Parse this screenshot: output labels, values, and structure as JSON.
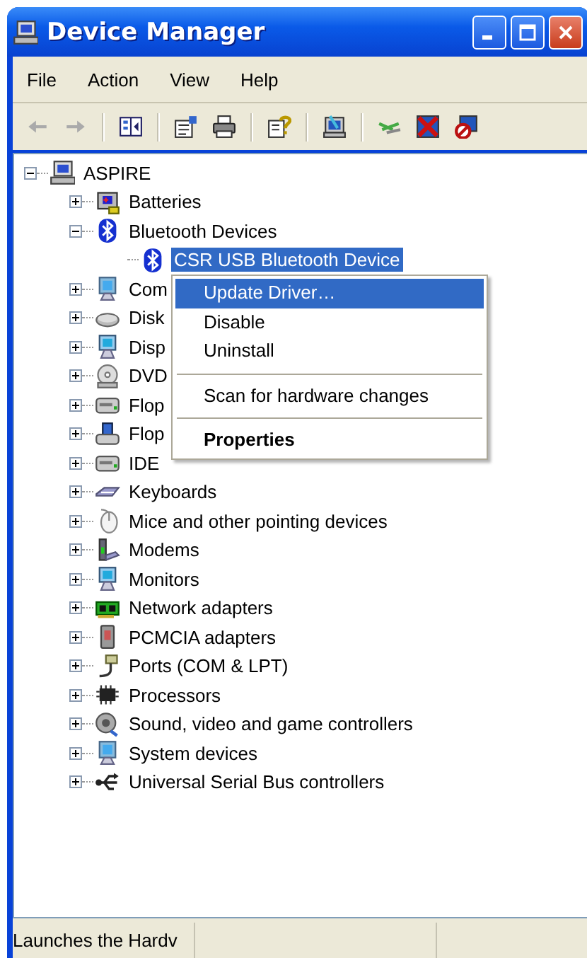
{
  "window": {
    "title": "Device Manager"
  },
  "menu_bar": [
    "File",
    "Action",
    "View",
    "Help"
  ],
  "toolbar": [
    {
      "kind": "back",
      "disabled": true
    },
    {
      "kind": "forward",
      "disabled": true
    },
    {
      "kind": "separator"
    },
    {
      "kind": "tree-toggle"
    },
    {
      "kind": "separator"
    },
    {
      "kind": "properties"
    },
    {
      "kind": "print"
    },
    {
      "kind": "separator"
    },
    {
      "kind": "help"
    },
    {
      "kind": "separator"
    },
    {
      "kind": "scan"
    },
    {
      "kind": "separator"
    },
    {
      "kind": "cable"
    },
    {
      "kind": "disable"
    },
    {
      "kind": "uninstall"
    }
  ],
  "tree": {
    "label": "ASPIRE",
    "kind": "computer",
    "expanded": true,
    "selected": false,
    "children": [
      {
        "label": "Batteries",
        "kind": "battery",
        "expanded": false,
        "selected": false
      },
      {
        "label": "Bluetooth Devices",
        "kind": "bluetooth",
        "expanded": true,
        "selected": false,
        "children": [
          {
            "label": "CSR USB Bluetooth Device",
            "kind": "bluetooth",
            "selected": true
          }
        ]
      },
      {
        "label": "Com",
        "kind": "computer-screen",
        "expanded": false,
        "selected": false
      },
      {
        "label": "Disk",
        "kind": "disk",
        "expanded": false,
        "selected": false
      },
      {
        "label": "Disp",
        "kind": "monitor",
        "expanded": false,
        "selected": false
      },
      {
        "label": "DVD",
        "kind": "dvd",
        "expanded": false,
        "selected": false
      },
      {
        "label": "Flop",
        "kind": "drive",
        "expanded": false,
        "selected": false
      },
      {
        "label": "Flop",
        "kind": "floppy",
        "expanded": false,
        "selected": false
      },
      {
        "label": "IDE",
        "kind": "drive",
        "expanded": false,
        "selected": false
      },
      {
        "label": "Keyboards",
        "kind": "keyboard",
        "expanded": false,
        "selected": false
      },
      {
        "label": "Mice and other pointing devices",
        "kind": "mouse",
        "expanded": false,
        "selected": false
      },
      {
        "label": "Modems",
        "kind": "modem",
        "expanded": false,
        "selected": false
      },
      {
        "label": "Monitors",
        "kind": "monitor",
        "expanded": false,
        "selected": false
      },
      {
        "label": "Network adapters",
        "kind": "network",
        "expanded": false,
        "selected": false
      },
      {
        "label": "PCMCIA adapters",
        "kind": "card",
        "expanded": false,
        "selected": false
      },
      {
        "label": "Ports (COM & LPT)",
        "kind": "port",
        "expanded": false,
        "selected": false
      },
      {
        "label": "Processors",
        "kind": "chip",
        "expanded": false,
        "selected": false
      },
      {
        "label": "Sound, video and game controllers",
        "kind": "speaker",
        "expanded": false,
        "selected": false
      },
      {
        "label": "System devices",
        "kind": "computer-screen",
        "expanded": false,
        "selected": false
      },
      {
        "label": "Universal Serial Bus controllers",
        "kind": "usb",
        "expanded": false,
        "selected": false
      }
    ]
  },
  "context_menu": [
    {
      "kind": "item",
      "label": "Update Driver…",
      "selected": true,
      "bold": false
    },
    {
      "kind": "item",
      "label": "Disable",
      "selected": false,
      "bold": false
    },
    {
      "kind": "item",
      "label": "Uninstall",
      "selected": false,
      "bold": false
    },
    {
      "kind": "separator"
    },
    {
      "kind": "item",
      "label": "Scan for hardware changes",
      "selected": false,
      "bold": false
    },
    {
      "kind": "separator"
    },
    {
      "kind": "item",
      "label": "Properties",
      "selected": false,
      "bold": true
    }
  ],
  "status_bar": {
    "text": "Launches the Hardv"
  }
}
